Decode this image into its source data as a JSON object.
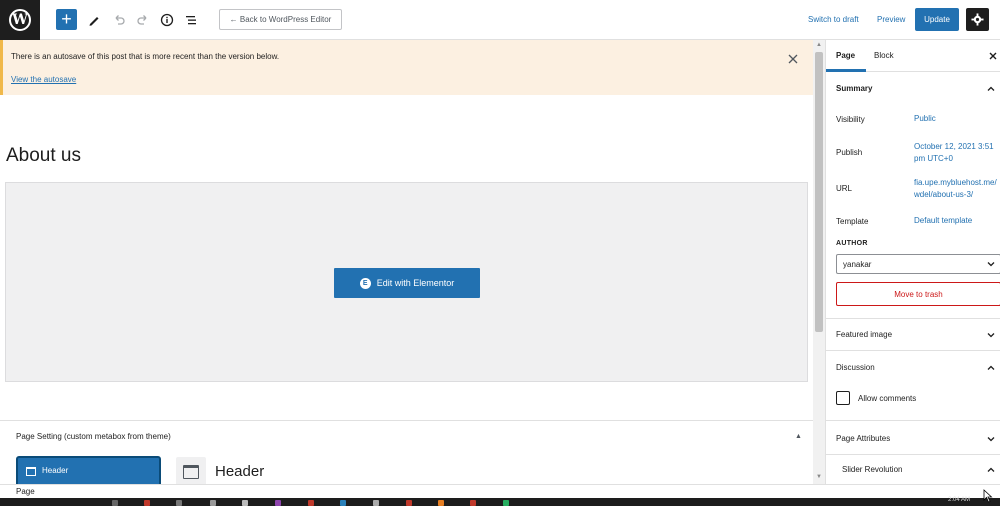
{
  "topbar": {
    "add_label": "+",
    "back_label": "← Back to WordPress Editor",
    "switch_to_draft": "Switch to draft",
    "preview": "Preview",
    "update": "Update"
  },
  "notice": {
    "message": "There is an autosave of this post that is more recent than the version below.",
    "link": "View the autosave"
  },
  "editor": {
    "page_title": "About us",
    "elementor_button": "Edit with Elementor",
    "elementor_icon": "E"
  },
  "metabox": {
    "title": "Page Setting (custom metabox from theme)",
    "header_option": "Header",
    "header_preview_label": "Header"
  },
  "sidebar": {
    "tabs": [
      {
        "label": "Page",
        "active": true
      },
      {
        "label": "Block",
        "active": false
      }
    ],
    "summary": {
      "heading": "Summary",
      "rows": [
        {
          "label": "Visibility",
          "value": "Public"
        },
        {
          "label": "Publish",
          "value": "October 12, 2021 3:51 pm UTC+0"
        },
        {
          "label": "URL",
          "value": "fia.upe.mybluehost.me/wdel/about-us-3/"
        },
        {
          "label": "Template",
          "value": "Default template"
        }
      ],
      "author_label": "AUTHOR",
      "author_value": "yanakar",
      "trash_label": "Move to trash"
    },
    "panels": {
      "featured_image": "Featured image",
      "discussion": "Discussion",
      "allow_comments": "Allow comments",
      "page_attributes": "Page Attributes",
      "slider_revolution": "Slider Revolution"
    }
  },
  "footer": {
    "breadcrumb": "Page"
  },
  "taskbar": {
    "clock": "2:04 AM"
  },
  "colors": {
    "accent": "#2271b1",
    "notice_bg": "#fcf0e1",
    "notice_border": "#f0b849",
    "danger": "#cc1818",
    "dark": "#1e1e1e"
  }
}
